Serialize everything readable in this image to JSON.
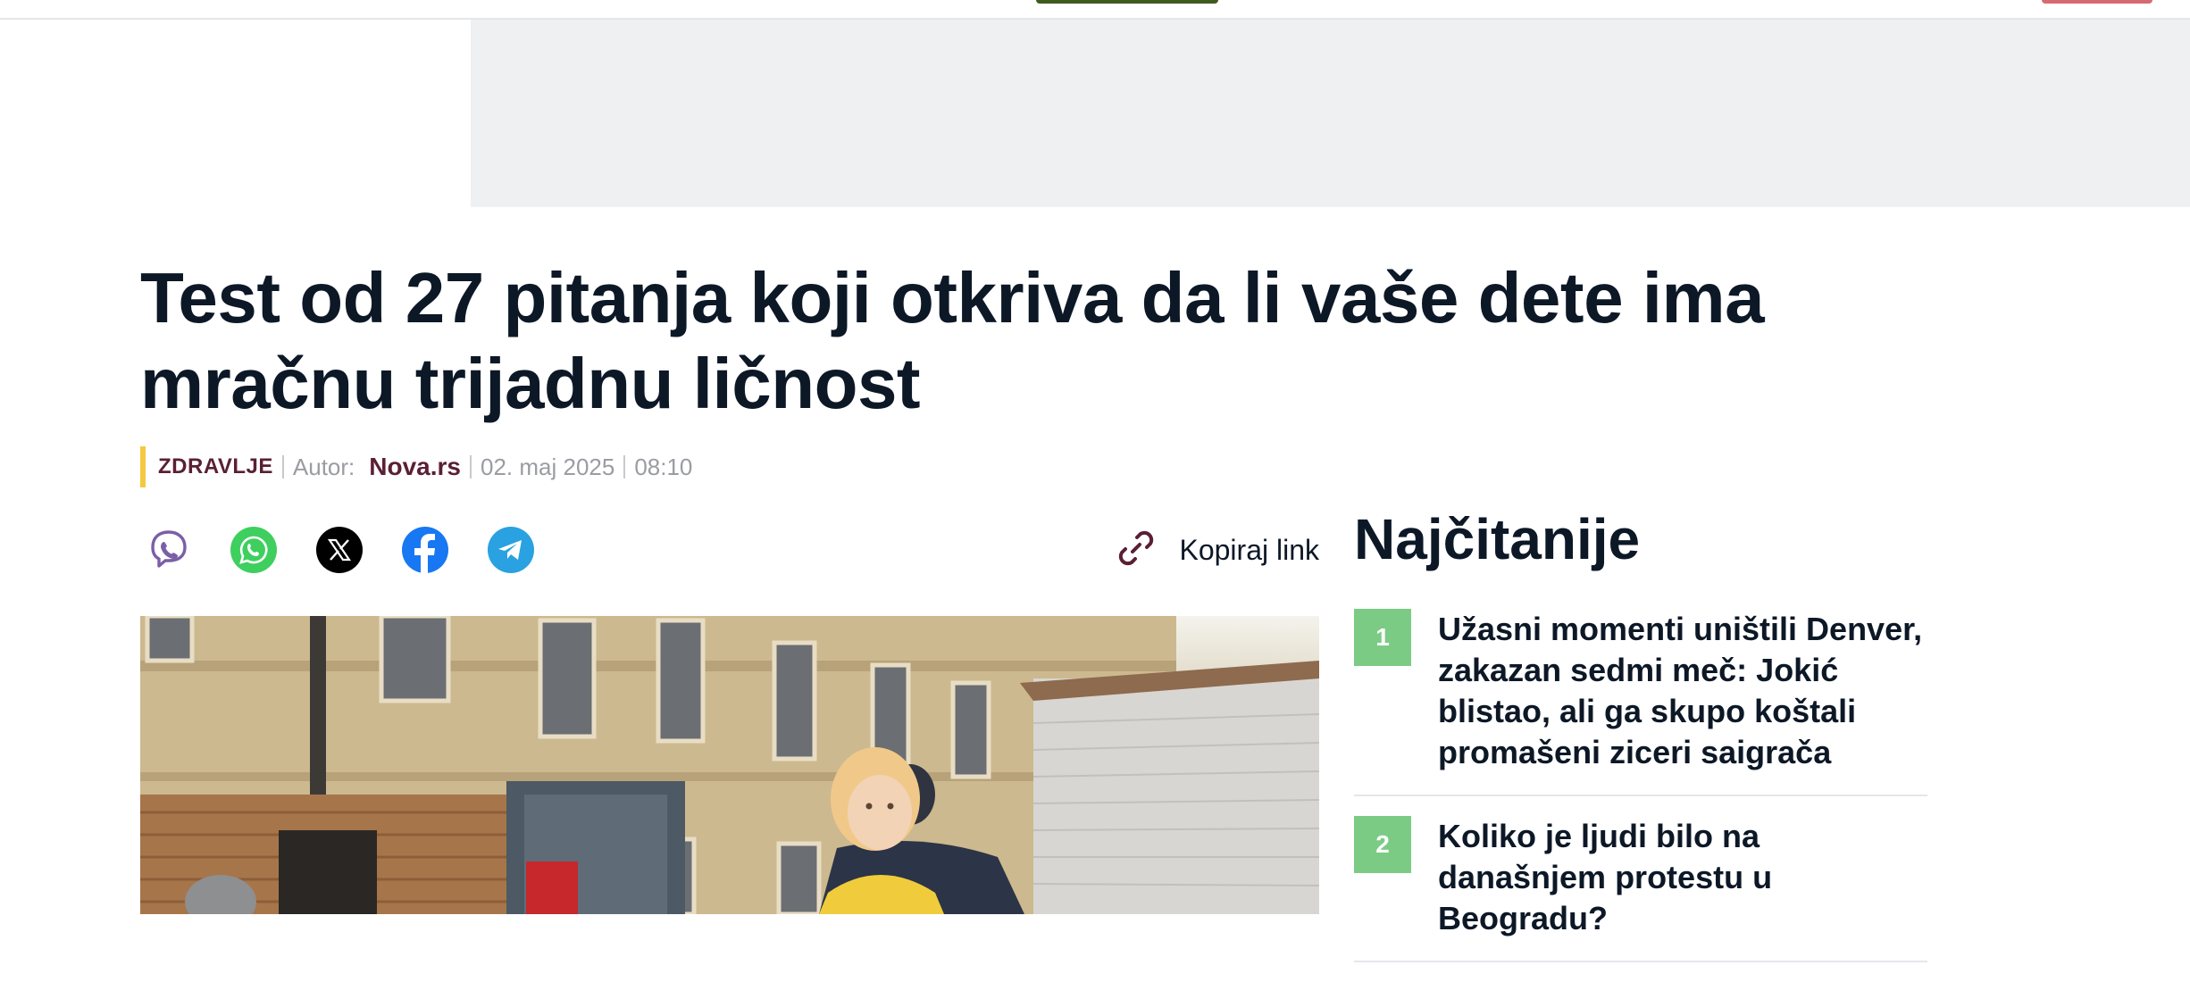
{
  "article": {
    "headline": "Test od 27 pitanja koji otkriva da li vaše dete ima mračnu trijadnu ličnost",
    "category": "ZDRAVLJE",
    "author_label": "Autor:",
    "author": "Nova.rs",
    "date": "02. maj 2025",
    "time": "08:10"
  },
  "share": {
    "icons": [
      "viber-icon",
      "whatsapp-icon",
      "x-icon",
      "facebook-icon",
      "telegram-icon"
    ],
    "copy_link_label": "Kopiraj link"
  },
  "most_read": {
    "title": "Najčitanije",
    "items": [
      {
        "rank": "1",
        "title": "Užasni momenti uništili Denver, zakazan sedmi meč: Jokić blistao, ali ga skupo koštali promašeni ziceri saigrača"
      },
      {
        "rank": "2",
        "title": "Koliko je ljudi bilo na današnjem protestu u Beogradu?"
      }
    ]
  },
  "colors": {
    "accent": "#5a1f35",
    "category_bar": "#f5c842",
    "rank_badge": "#7ccb85",
    "ad_background": "#eff0f2"
  }
}
